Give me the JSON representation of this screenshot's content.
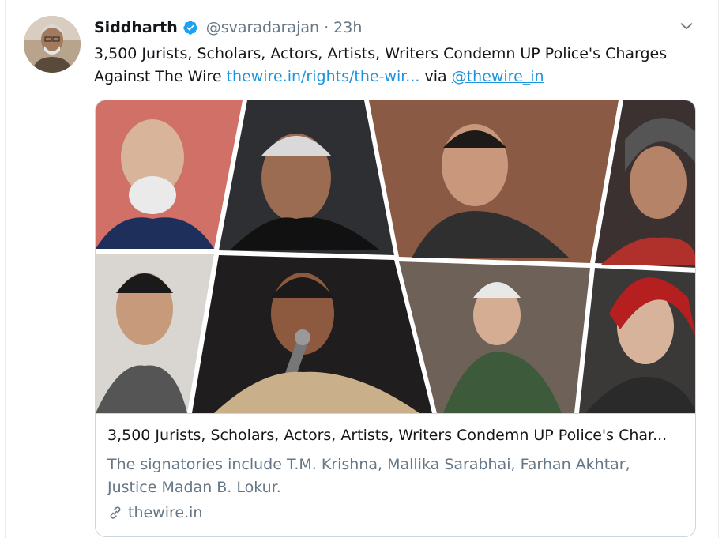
{
  "tweet": {
    "author_name": "Siddharth",
    "handle": "@svaradarajan",
    "separator": "·",
    "time": "23h",
    "text_main": "3,500 Jurists, Scholars, Actors, Artists, Writers Condemn UP Police's Charges Against The Wire",
    "link_text": "thewire.in/rights/the-wir...",
    "via_text": "via",
    "mention": "@thewire_in"
  },
  "card": {
    "title": "3,500 Jurists, Scholars, Actors, Artists, Writers Condemn UP Police's Char...",
    "description": "The signatories include T.M. Krishna, Mallika Sarabhai, Farhan Akhtar, Justice Madan B. Lokur.",
    "domain": "thewire.in"
  },
  "icons": {
    "verified": "verified-badge-icon",
    "caret": "chevron-down-icon",
    "link": "link-icon"
  },
  "colors": {
    "accent": "#1b95e0",
    "muted": "#657786",
    "border": "#ccd6dd"
  }
}
